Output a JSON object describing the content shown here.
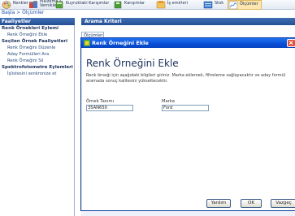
{
  "toolbar": {
    "items": [
      {
        "label": "Renkler",
        "icon": "palette-icon"
      },
      {
        "label": "Malzeme &\nVernikler",
        "icon": "paint-cans-icon"
      },
      {
        "label": "Kuyruktaki Karışımlar",
        "icon": "queue-mixes-icon"
      },
      {
        "label": "Karışımlar",
        "icon": "mixes-icon"
      },
      {
        "label": "İş emirleri",
        "icon": "work-orders-icon"
      },
      {
        "label": "Stok",
        "icon": "stock-icon"
      },
      {
        "label": "Ölçümler",
        "icon": "measurements-icon"
      }
    ],
    "active": "Ölçümler"
  },
  "breadcrumb": "Başla > Ölçümler",
  "left": {
    "header": "Faaliyetler",
    "sections": [
      {
        "title": "Renk Örnekleri Eylemi",
        "items": [
          "Renk Örneğini Ekle"
        ]
      },
      {
        "title": "Seçilen Örnek Faaliyetleri",
        "items": [
          "Renk Örneğini Düzenle",
          "Aday Formülleri Ara",
          "Renk Örneğini Sil"
        ]
      },
      {
        "title": "Spektrofotometre Eylemleri",
        "items": [
          "İşlistesini senkronize et"
        ]
      }
    ]
  },
  "right": {
    "header": "Arama Kriteri",
    "tab": "Ölçümler"
  },
  "dialog": {
    "title": "Renk Örneğini Ekle",
    "heading": "Renk Örneğini Ekle",
    "description": "Renk örneği için aşağıdaki bilgileri giriniz. Marka eklemek, filtreleme sağlayacaktır ve aday formül aramada sonuç kalitesini yükseltecektir.",
    "fields": {
      "sample_label": "Örnek Tanımı",
      "sample_value": "35AN650",
      "brand_label": "Marka",
      "brand_value": "Ford"
    },
    "buttons": {
      "help": "Yardım",
      "ok": "OK",
      "cancel": "Vazgeç"
    }
  },
  "colors": {
    "header_blue": "#2f5fa8",
    "titlebar_blue": "#0a4fd6",
    "close_red": "#e1533c"
  }
}
